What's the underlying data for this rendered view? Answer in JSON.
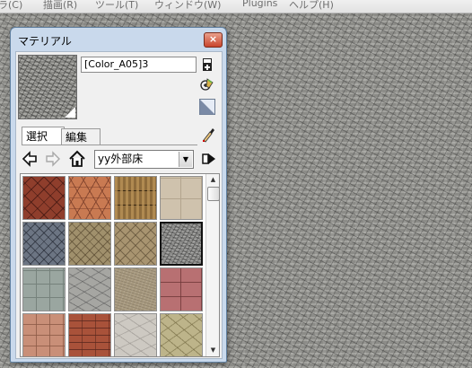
{
  "menubar": {
    "items": [
      "ラ(C)",
      "描画(R)",
      "ツール(T)",
      "ウィンドウ(W)",
      "Plugins",
      "ヘルプ(H)"
    ]
  },
  "panel": {
    "title": "マテリアル",
    "close_label": "×",
    "material_name": "[Color_A05]3",
    "tabs": {
      "select": "選択",
      "edit": "編集"
    },
    "collection": "yy外部床",
    "swatches": [
      "redbrick",
      "hex",
      "parquet",
      "beigetile",
      "bluegrey",
      "tanbrick",
      "tanbrick2",
      "gravel",
      "greenstone",
      "greystone",
      "concrete",
      "pinktile",
      "pinkpaver",
      "brick",
      "whitestone",
      "yellowstone"
    ]
  }
}
